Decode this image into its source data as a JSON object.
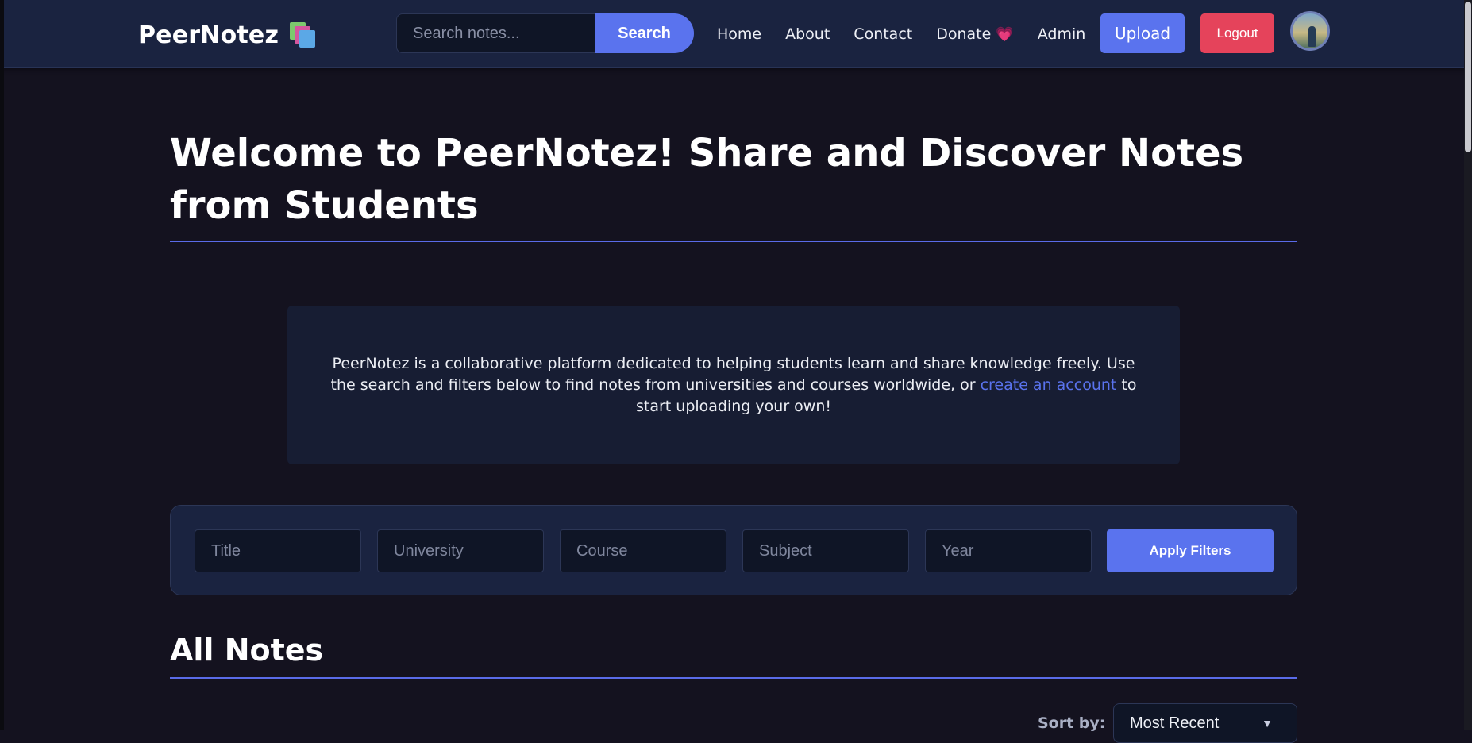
{
  "navbar": {
    "brand": "PeerNotez",
    "brand_icon": "stacked-books-icon",
    "search": {
      "placeholder": "Search notes...",
      "value": "",
      "button_label": "Search"
    },
    "links": [
      {
        "label": "Home"
      },
      {
        "label": "About"
      },
      {
        "label": "Contact"
      },
      {
        "label": "Donate",
        "icon": "heart-icon",
        "glyph": "💗"
      },
      {
        "label": "Admin"
      }
    ],
    "upload_label": "Upload",
    "logout_label": "Logout",
    "avatar": "user-avatar"
  },
  "main": {
    "title": "Welcome to PeerNotez! Share and Discover Notes from Students",
    "intro": {
      "text_before": "PeerNotez is a collaborative platform dedicated to helping students learn and share knowledge freely. Use the search and filters below to find notes from universities and courses worldwide, or ",
      "link_text": "create an account",
      "text_after": " to start uploading your own!"
    },
    "filters": {
      "title_placeholder": "Title",
      "university_placeholder": "University",
      "course_placeholder": "Course",
      "subject_placeholder": "Subject",
      "year_placeholder": "Year",
      "apply_label": "Apply Filters"
    },
    "section_title": "All Notes",
    "sort": {
      "label": "Sort by:",
      "selected": "Most Recent",
      "arrow": "▼"
    }
  },
  "colors": {
    "page_bg": "#14121f",
    "navbar_bg": "#1a2340",
    "accent": "#5a73ee",
    "danger": "#e5435b",
    "panel_bg": "#171d33"
  }
}
